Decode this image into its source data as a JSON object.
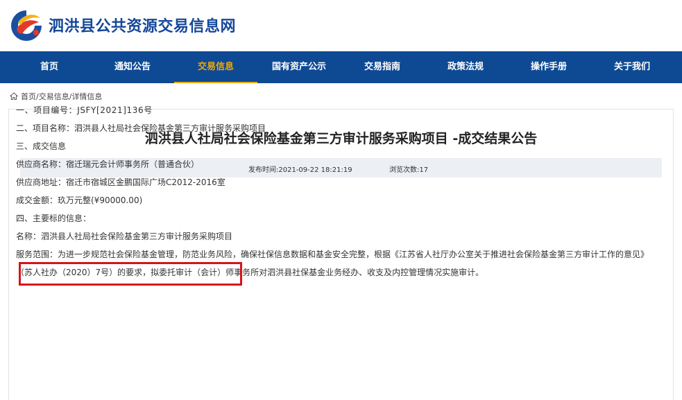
{
  "header": {
    "site_title": "泗洪县公共资源交易信息网",
    "brand_color": "#0e4a94",
    "logo_icon": "logo-mark"
  },
  "nav": {
    "items": [
      {
        "label": "首页"
      },
      {
        "label": "通知公告"
      },
      {
        "label": "交易信息",
        "active": true
      },
      {
        "label": "国有资产公示"
      },
      {
        "label": "交易指南"
      },
      {
        "label": "政策法规"
      },
      {
        "label": "操作手册"
      },
      {
        "label": "关于我们"
      }
    ],
    "active_color": "#f0a800"
  },
  "breadcrumb": {
    "icon": "home-icon",
    "home": "首页/",
    "section": "交易信息/",
    "current": "详情信息"
  },
  "article": {
    "title": "泗洪县人社局社会保险基金第三方审计服务采购项目 -成交结果公告",
    "publish_time": "发布时间:2021-09-22 18:21:19",
    "views": "浏览次数:17",
    "lines": [
      "一、项目编号：JSFY[2021]136号",
      "二、项目名称：泗洪县人社局社会保险基金第三方审计服务采购项目",
      "三、成交信息",
      "供应商名称：宿迁瑞元会计师事务所（普通合伙）",
      "供应商地址：宿迁市宿城区金鹏国际广场C2012-2016室",
      "成交金额：玖万元整(¥90000.00)",
      "四、主要标的信息：",
      "名称：泗洪县人社局社会保险基金第三方审计服务采购项目",
      "服务范围：为进一步规范社会保险基金管理，防范业务风险，确保社保信息数据和基金安全完整，根据《江苏省人社厅办公室关于推进社会保险基金第三方审计工作的意见》（苏人社办（2020）7号）的要求，拟委托审计（会计）师事务所对泗洪县社保基金业务经办、收支及内控管理情况实施审计。"
    ],
    "highlight_color": "#d9121c"
  }
}
